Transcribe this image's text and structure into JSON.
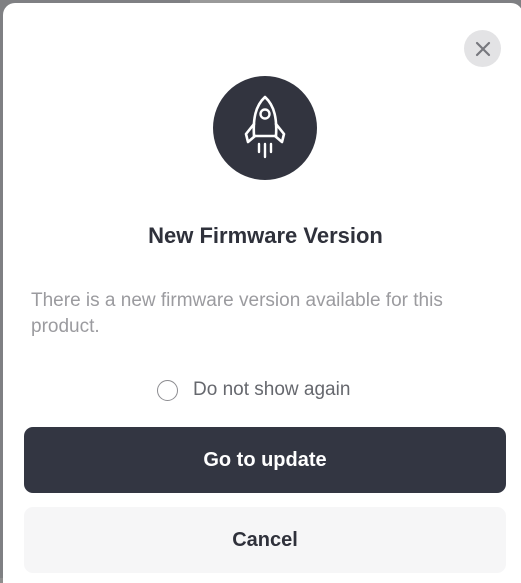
{
  "dialog": {
    "title": "New Firmware Version",
    "message": "There is a new firmware version available for this product.",
    "checkbox_label": "Do not show again",
    "checkbox_checked": false,
    "primary_button": "Go to update",
    "secondary_button": "Cancel",
    "hero_icon": "rocket-icon",
    "close_icon": "close-icon"
  },
  "colors": {
    "primary": "#333642",
    "muted_text": "#9b9b9f",
    "title_text": "#2f313b"
  }
}
